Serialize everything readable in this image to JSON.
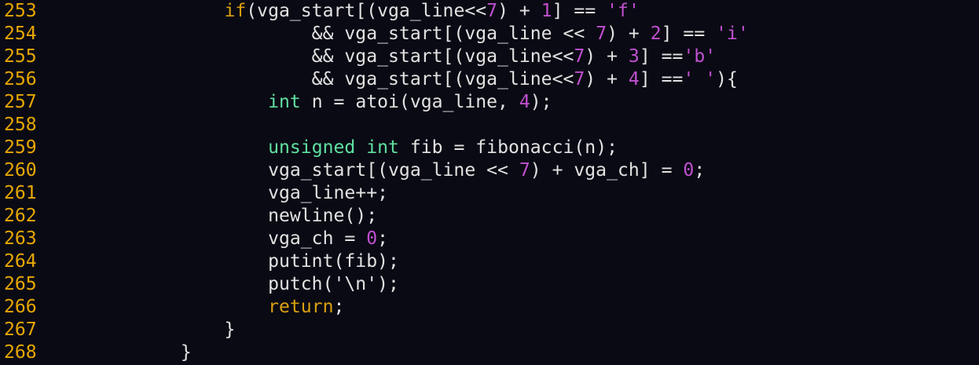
{
  "editor": {
    "lines": [
      {
        "number": "253",
        "tokens": [
          [
            "txt",
            "                "
          ],
          [
            "kw",
            "if"
          ],
          [
            "txt",
            "(vga_start[(vga_line<<"
          ],
          [
            "num",
            "7"
          ],
          [
            "txt",
            ") + "
          ],
          [
            "num",
            "1"
          ],
          [
            "txt",
            "] == "
          ],
          [
            "str",
            "'f'"
          ]
        ]
      },
      {
        "number": "254",
        "tokens": [
          [
            "txt",
            "                        && vga_start[(vga_line << "
          ],
          [
            "num",
            "7"
          ],
          [
            "txt",
            ") + "
          ],
          [
            "num",
            "2"
          ],
          [
            "txt",
            "] == "
          ],
          [
            "str",
            "'i'"
          ]
        ]
      },
      {
        "number": "255",
        "tokens": [
          [
            "txt",
            "                        && vga_start[(vga_line<<"
          ],
          [
            "num",
            "7"
          ],
          [
            "txt",
            ") + "
          ],
          [
            "num",
            "3"
          ],
          [
            "txt",
            "] =="
          ],
          [
            "str",
            "'b'"
          ]
        ]
      },
      {
        "number": "256",
        "tokens": [
          [
            "txt",
            "                        && vga_start[(vga_line<<"
          ],
          [
            "num",
            "7"
          ],
          [
            "txt",
            ") + "
          ],
          [
            "num",
            "4"
          ],
          [
            "txt",
            "] =="
          ],
          [
            "str",
            "' '"
          ],
          [
            "txt",
            "){"
          ]
        ]
      },
      {
        "number": "257",
        "tokens": [
          [
            "txt",
            "                    "
          ],
          [
            "type",
            "int"
          ],
          [
            "txt",
            " n = atoi(vga_line, "
          ],
          [
            "num",
            "4"
          ],
          [
            "txt",
            ");"
          ]
        ]
      },
      {
        "number": "258",
        "tokens": []
      },
      {
        "number": "259",
        "tokens": [
          [
            "txt",
            "                    "
          ],
          [
            "type",
            "unsigned"
          ],
          [
            "txt",
            " "
          ],
          [
            "type",
            "int"
          ],
          [
            "txt",
            " fib = fibonacci(n);"
          ]
        ]
      },
      {
        "number": "260",
        "tokens": [
          [
            "txt",
            "                    vga_start[(vga_line << "
          ],
          [
            "num",
            "7"
          ],
          [
            "txt",
            ") + vga_ch] = "
          ],
          [
            "num",
            "0"
          ],
          [
            "txt",
            ";"
          ]
        ]
      },
      {
        "number": "261",
        "tokens": [
          [
            "txt",
            "                    vga_line++;"
          ]
        ]
      },
      {
        "number": "262",
        "tokens": [
          [
            "txt",
            "                    newline();"
          ]
        ]
      },
      {
        "number": "263",
        "tokens": [
          [
            "txt",
            "                    vga_ch = "
          ],
          [
            "num",
            "0"
          ],
          [
            "txt",
            ";"
          ]
        ]
      },
      {
        "number": "264",
        "tokens": [
          [
            "txt",
            "                    putint(fib);"
          ]
        ]
      },
      {
        "number": "265",
        "tokens": [
          [
            "txt",
            "                    putch('\\n');"
          ]
        ]
      },
      {
        "number": "266",
        "tokens": [
          [
            "txt",
            "                    "
          ],
          [
            "kw",
            "return"
          ],
          [
            "txt",
            ";"
          ]
        ]
      },
      {
        "number": "267",
        "tokens": [
          [
            "txt",
            "                }"
          ]
        ]
      },
      {
        "number": "268",
        "tokens": [
          [
            "txt",
            "            }"
          ]
        ]
      }
    ]
  },
  "colors": {
    "background": "#0a0a14",
    "line_number": "#e8a800",
    "keyword": "#d9a010",
    "type": "#5fe0a0",
    "number": "#c050d0",
    "text": "#e2e2e2"
  }
}
